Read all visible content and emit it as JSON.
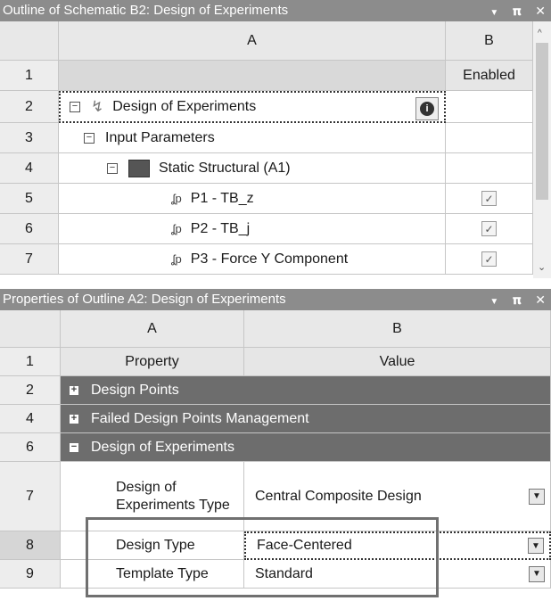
{
  "outline": {
    "title": "Outline of Schematic B2: Design of Experiments",
    "col_a": "A",
    "col_b": "B",
    "header_b": "Enabled",
    "row_numbers": [
      "1",
      "2",
      "3",
      "4",
      "5",
      "6",
      "7"
    ],
    "design_of_experiments": "Design of Experiments",
    "input_parameters": "Input Parameters",
    "static_structural": "Static Structural (A1)",
    "p1": "P1 - TB_z",
    "p2": "P2 - TB_j",
    "p3": "P3 - Force Y Component",
    "param_glyph": "ду"
  },
  "properties": {
    "title": "Properties of Outline A2: Design of Experiments",
    "col_a": "A",
    "col_b": "B",
    "row_numbers": [
      "1",
      "2",
      "4",
      "6",
      "7",
      "8",
      "9"
    ],
    "header_property": "Property",
    "header_value": "Value",
    "design_points": "Design Points",
    "failed_design_points": "Failed Design Points Management",
    "design_of_experiments": "Design of Experiments",
    "doe_type_label": "Design of Experiments Type",
    "doe_type_value": "Central Composite Design",
    "design_type_label": "Design Type",
    "design_type_value": "Face-Centered",
    "template_type_label": "Template Type",
    "template_type_value": "Standard"
  },
  "icons": {
    "dropdown": "chevron-down-icon",
    "pin": "pin-icon",
    "close": "close-icon",
    "lightning": "lightning-icon",
    "info": "info-icon",
    "param": "parameter-icon",
    "static_structural": "static-structural-icon"
  },
  "colors": {
    "titlebar": "#8c8c8c",
    "group_row": "#6d6d6d",
    "selection_outline": "#555555",
    "highlight_box": "#707070"
  }
}
